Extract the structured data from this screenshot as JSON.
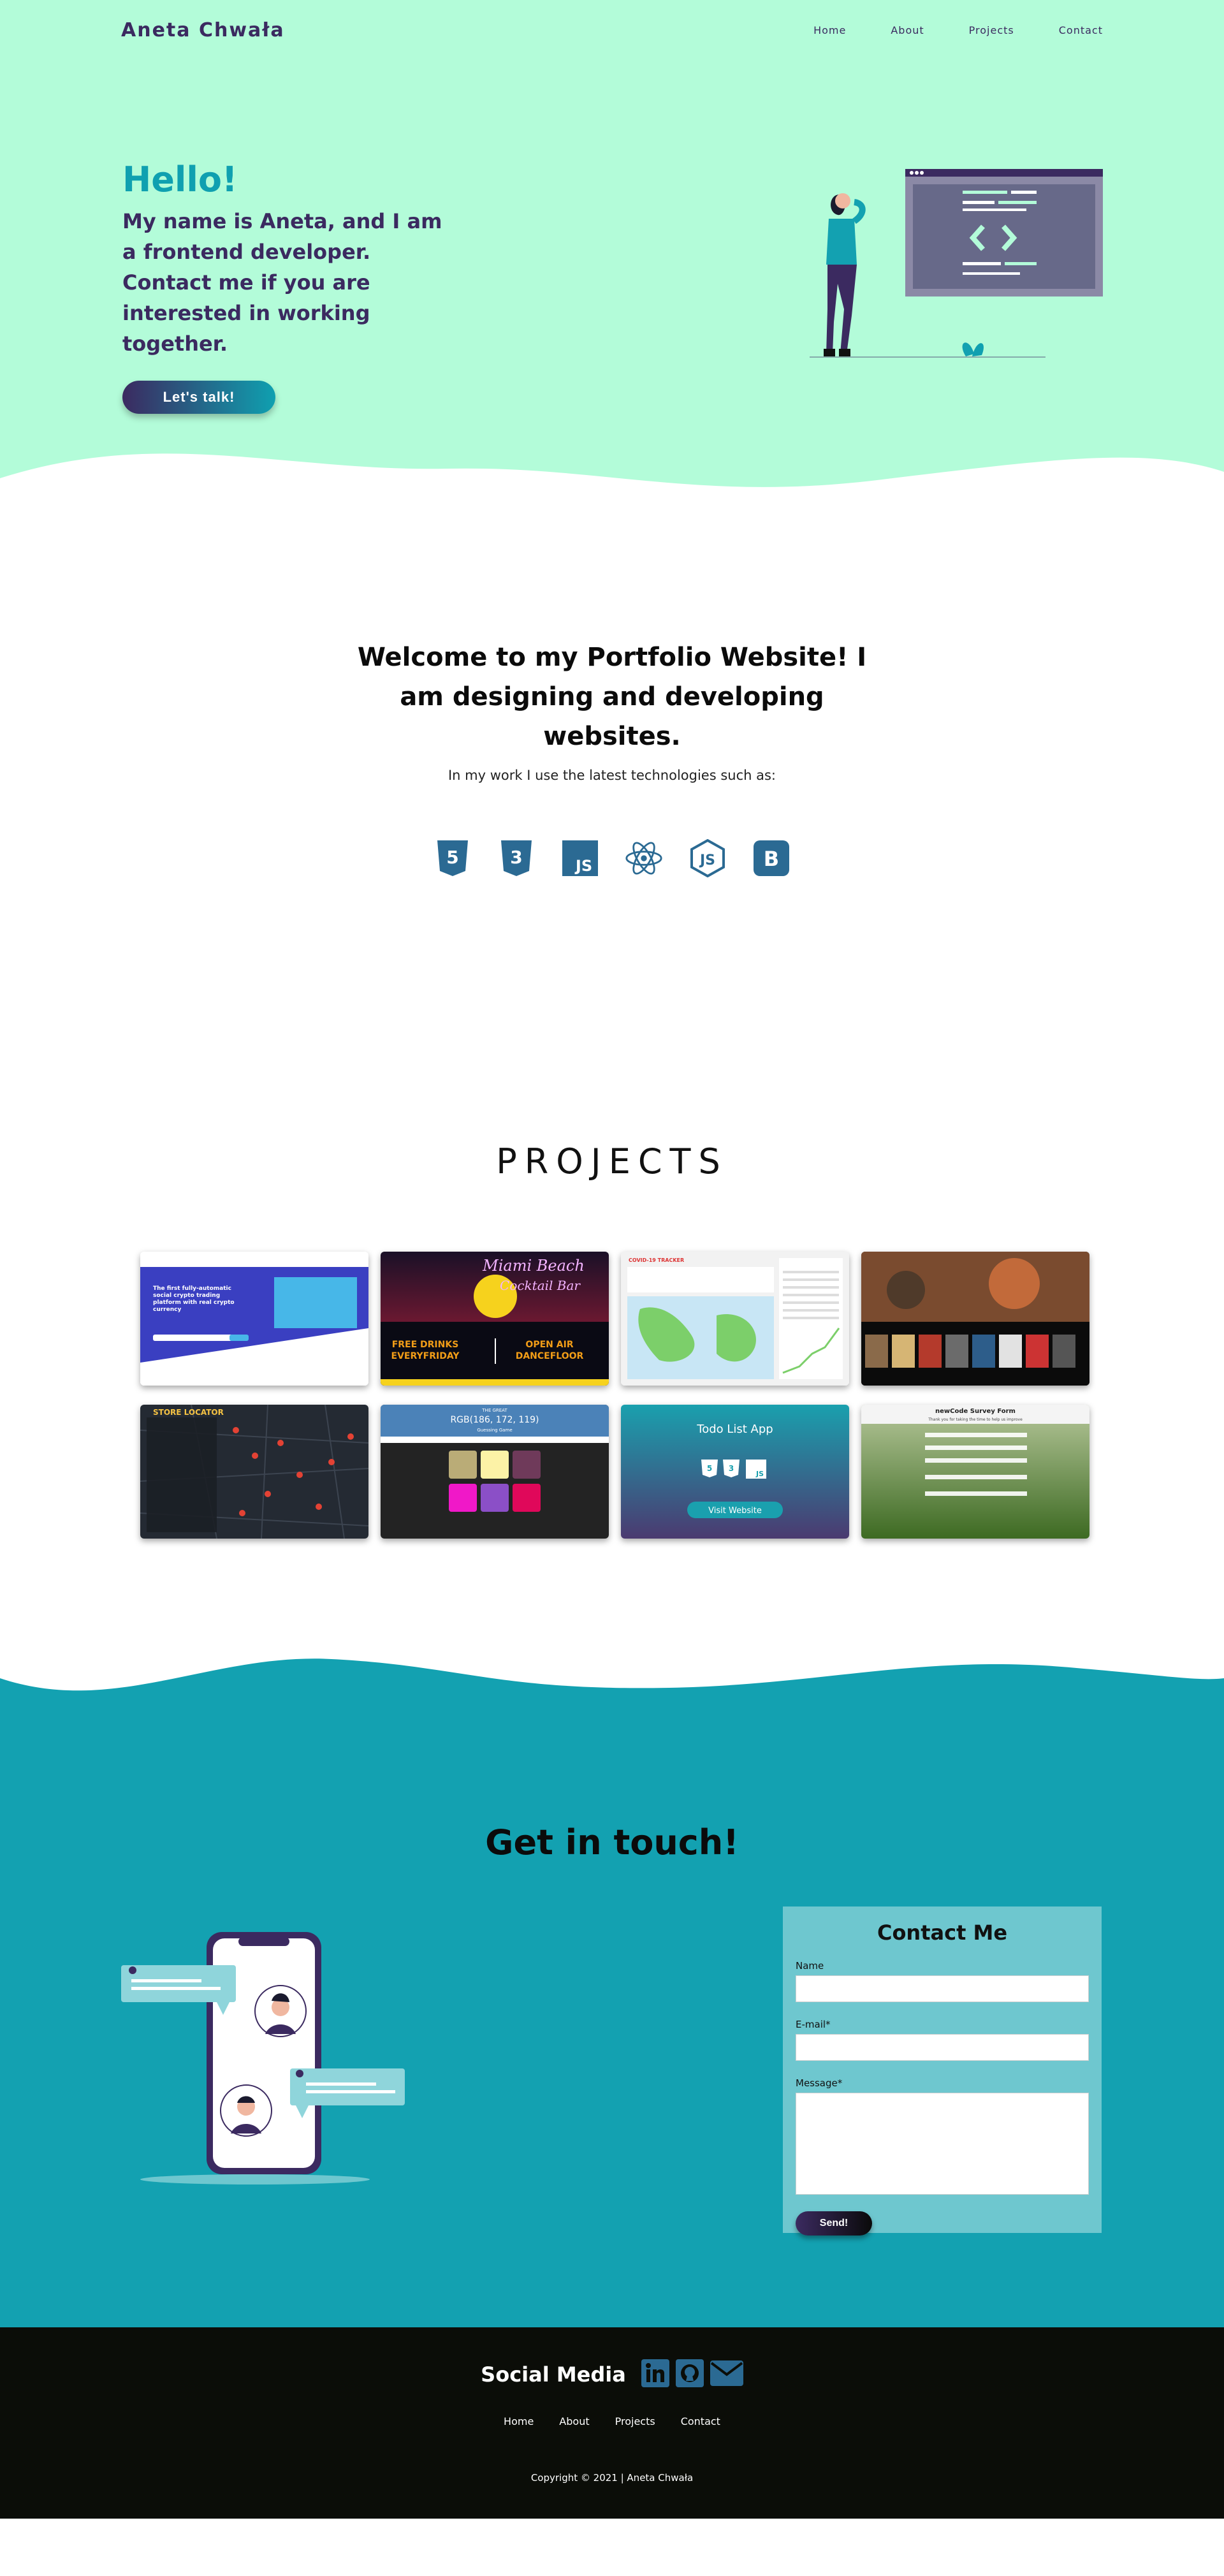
{
  "header": {
    "logo": "Aneta Chwała",
    "nav": [
      "Home",
      "About",
      "Projects",
      "Contact"
    ]
  },
  "hero": {
    "greeting": "Hello!",
    "intro": "My name is Aneta, and I am a frontend developer. Contact me if you are interested in working together.",
    "cta_label": "Let's talk!"
  },
  "about": {
    "heading": "Welcome to my Portfolio Website! I am designing and developing websites.",
    "subheading": "In my work I use the latest technologies such as:",
    "tech_icons": [
      "html5-icon",
      "css3-icon",
      "javascript-icon",
      "react-icon",
      "nodejs-icon",
      "bootstrap-icon"
    ]
  },
  "projects": {
    "heading": "PROJECTS",
    "cards": [
      {
        "icon": "crypto-landing-thumbnail",
        "text": "The first fully-automatic social crypto trading platform with real crypto currency"
      },
      {
        "icon": "cocktail-bar-thumbnail",
        "neon_title": "Miami Beach",
        "neon_subtitle": "Cocktail Bar",
        "left_text": "FREE DRINKS EVERYFRIDAY",
        "right_text": "OPEN AIR DANCEFLOOR"
      },
      {
        "icon": "covid-tracker-thumbnail",
        "title": "COVID-19 TRACKER"
      },
      {
        "icon": "movie-streaming-thumbnail"
      },
      {
        "icon": "store-locator-thumbnail",
        "title": "STORE LOCATOR"
      },
      {
        "icon": "color-game-thumbnail",
        "header": "THE GREAT",
        "rgb": "RGB(186, 172, 119)",
        "sub": "Guessing Game"
      },
      {
        "icon": "todo-app-thumbnail",
        "title": "Todo List App",
        "button": "Visit Website"
      },
      {
        "icon": "survey-form-thumbnail",
        "title": "newCode Survey Form",
        "subtitle": "Thank you for taking the time to help us improve"
      }
    ]
  },
  "contact": {
    "heading": "Get in touch!",
    "form_title": "Contact Me",
    "name_label": "Name",
    "email_label": "E-mail*",
    "message_label": "Message*",
    "send_label": "Send!"
  },
  "footer": {
    "social_title": "Social Media",
    "social_icons": [
      "linkedin-icon",
      "github-icon",
      "email-icon"
    ],
    "nav": [
      "Home",
      "About",
      "Projects",
      "Contact"
    ],
    "copyright": "Copyright © 2021 | Aneta Chwała"
  },
  "colors": {
    "hero_bg": "#b3fcd9",
    "primary_purple": "#3b2a60",
    "teal": "#0fa0b0",
    "contact_bg": "#13a1b1",
    "form_bg": "#6ec7cf",
    "footer_bg": "#0b0d08",
    "tech_icon": "#2b6a93"
  }
}
